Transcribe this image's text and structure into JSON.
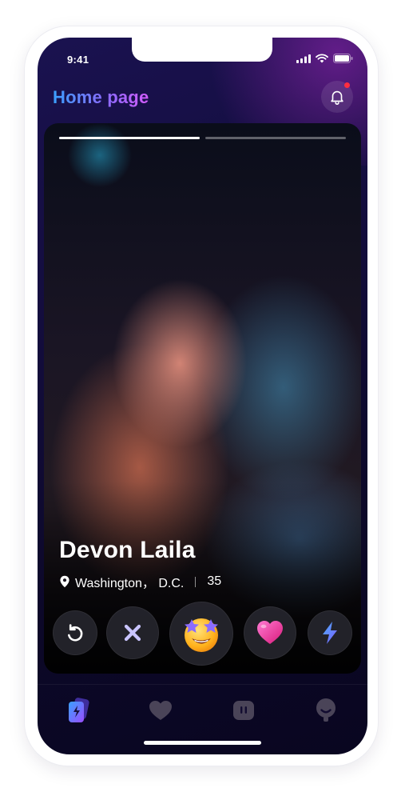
{
  "status_bar": {
    "time": "9:41",
    "icons": [
      "signal-icon",
      "wifi-icon",
      "battery-icon"
    ]
  },
  "header": {
    "title": "Home page",
    "notification_icon": "bell-icon",
    "has_unread": true
  },
  "profile": {
    "name": "Devon Laila",
    "location": "Washington， D.C.",
    "age": "35",
    "photo_count": 2,
    "current_photo": 1
  },
  "actions": [
    {
      "name": "rewind",
      "icon": "undo-icon"
    },
    {
      "name": "dislike",
      "icon": "close-icon"
    },
    {
      "name": "super-like",
      "icon": "star-eyes-emoji-icon"
    },
    {
      "name": "like",
      "icon": "heart-icon"
    },
    {
      "name": "boost",
      "icon": "lightning-icon"
    }
  ],
  "bottom_nav": [
    {
      "name": "cards",
      "icon": "cards-icon",
      "active": true
    },
    {
      "name": "likes",
      "icon": "heart-icon",
      "active": false
    },
    {
      "name": "messages",
      "icon": "chat-icon",
      "active": false
    },
    {
      "name": "profile",
      "icon": "person-icon",
      "active": false
    }
  ],
  "colors": {
    "title_gradient": [
      "#3aa0ff",
      "#8a6bff",
      "#d35cff"
    ],
    "notification_dot": "#ff2d3f",
    "accent_blue": "#3a8dff",
    "accent_purple": "#8a4dff"
  }
}
